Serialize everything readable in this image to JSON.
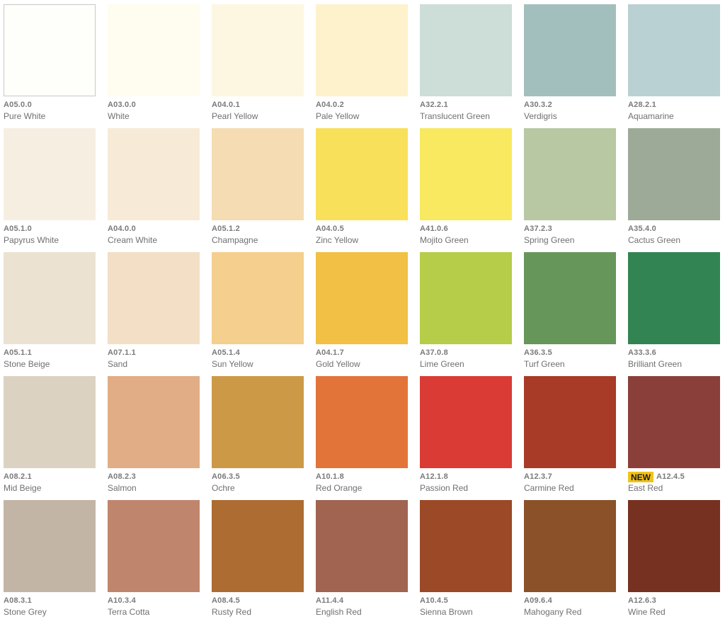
{
  "swatches": [
    {
      "code": "A05.0.0",
      "name": "Pure White",
      "color": "#fefefa",
      "border": true
    },
    {
      "code": "A03.0.0",
      "name": "White",
      "color": "#fffcf0"
    },
    {
      "code": "A04.0.1",
      "name": "Pearl Yellow",
      "color": "#fdf6e1"
    },
    {
      "code": "A04.0.2",
      "name": "Pale Yellow",
      "color": "#fdf2cb"
    },
    {
      "code": "A32.2.1",
      "name": "Translucent Green",
      "color": "#cdddd7"
    },
    {
      "code": "A30.3.2",
      "name": "Verdigris",
      "color": "#a3bfbd"
    },
    {
      "code": "A28.2.1",
      "name": "Aquamarine",
      "color": "#b9d1d3"
    },
    {
      "code": "A05.1.0",
      "name": "Papyrus White",
      "color": "#f7eee2"
    },
    {
      "code": "A04.0.0",
      "name": "Cream White",
      "color": "#f7ebd7"
    },
    {
      "code": "A05.1.2",
      "name": "Champagne",
      "color": "#f5dcb2"
    },
    {
      "code": "A04.0.5",
      "name": "Zinc Yellow",
      "color": "#f9e05a"
    },
    {
      "code": "A41.0.6",
      "name": "Mojito Green",
      "color": "#f8e960"
    },
    {
      "code": "A37.2.3",
      "name": "Spring Green",
      "color": "#b7c8a3"
    },
    {
      "code": "A35.4.0",
      "name": "Cactus Green",
      "color": "#9daa97"
    },
    {
      "code": "A05.1.1",
      "name": "Stone Beige",
      "color": "#ece2d1"
    },
    {
      "code": "A07.1.1",
      "name": "Sand",
      "color": "#f3dfc5"
    },
    {
      "code": "A05.1.4",
      "name": "Sun Yellow",
      "color": "#f4cf8d"
    },
    {
      "code": "A04.1.7",
      "name": "Gold Yellow",
      "color": "#f1c044"
    },
    {
      "code": "A37.0.8",
      "name": "Lime Green",
      "color": "#b5cd48"
    },
    {
      "code": "A36.3.5",
      "name": "Turf Green",
      "color": "#67965a"
    },
    {
      "code": "A33.3.6",
      "name": "Brilliant Green",
      "color": "#338453"
    },
    {
      "code": "A08.2.1",
      "name": "Mid Beige",
      "color": "#dcd2c1"
    },
    {
      "code": "A08.2.3",
      "name": "Salmon",
      "color": "#e1ad86"
    },
    {
      "code": "A06.3.5",
      "name": "Ochre",
      "color": "#cc9a46"
    },
    {
      "code": "A10.1.8",
      "name": "Red Orange",
      "color": "#e2743a"
    },
    {
      "code": "A12.1.8",
      "name": "Passion Red",
      "color": "#da3b34"
    },
    {
      "code": "A12.3.7",
      "name": "Carmine Red",
      "color": "#a83a28"
    },
    {
      "code": "A12.4.5",
      "name": "East Red",
      "color": "#8b3f3a",
      "badge": "NEW"
    },
    {
      "code": "A08.3.1",
      "name": "Stone Grey",
      "color": "#c3b5a6"
    },
    {
      "code": "A10.3.4",
      "name": "Terra Cotta",
      "color": "#c0856d"
    },
    {
      "code": "A08.4.5",
      "name": "Rusty Red",
      "color": "#ad6c32"
    },
    {
      "code": "A11.4.4",
      "name": "English Red",
      "color": "#a06451"
    },
    {
      "code": "A10.4.5",
      "name": "Sienna Brown",
      "color": "#9b4927"
    },
    {
      "code": "A09.6.4",
      "name": "Mahogany Red",
      "color": "#8b5129"
    },
    {
      "code": "A12.6.3",
      "name": "Wine Red",
      "color": "#763120"
    }
  ]
}
